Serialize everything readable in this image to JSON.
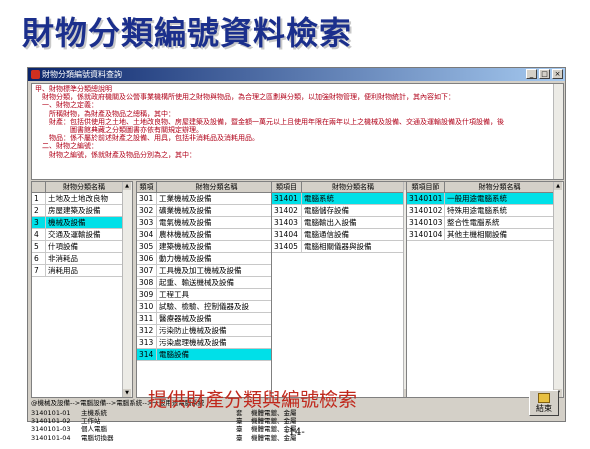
{
  "slide_title": "財物分類編號資料檢索",
  "window": {
    "title": "財物分類編號資料查詢",
    "controls": [
      "_",
      "□",
      "×"
    ]
  },
  "info_lines": [
    "甲、財物標準分類總說明",
    "　財物分類，係就政府機關及公營事業機構所使用之財物與物品，為合理之區劃與分類，以加強財物管理，便利財物統計，其內容如下：",
    "　一、財物之定義：",
    "　　所稱財物，為財產及物品之總稱，其中：",
    "　　財產：包括供使用之土地、土地改良物、房屋建築及設備，暨金額一萬元以上且使用年限在兩年以上之機械及設備、交通及運輸設備及什項設備，後",
    "　　　　　圖書館典藏之分類圖書亦依有關規定辦理。",
    "　　物品：係不屬於前述財產之設備、用具，包括非消耗品及消耗用品。",
    "　二、財物之編號：",
    "　　財物之編號，係就財產及物品分別為之，其中："
  ],
  "list1": {
    "headers": [
      "",
      "財物分類名稱"
    ],
    "rows": [
      [
        "1",
        "土地及土地改良物"
      ],
      [
        "2",
        "房屋建築及設備"
      ],
      [
        "3",
        "機械及設備"
      ],
      [
        "4",
        "交通及運輸設備"
      ],
      [
        "5",
        "什項設備"
      ],
      [
        "6",
        "非消耗品"
      ],
      [
        "7",
        "消耗用品"
      ]
    ],
    "selected": 2
  },
  "list2": {
    "headers": [
      "類項",
      "財物分類名稱"
    ],
    "rows": [
      [
        "301",
        "工業機械及設備"
      ],
      [
        "302",
        "礦業機械及設備"
      ],
      [
        "303",
        "電氣機械及設備"
      ],
      [
        "304",
        "農林機械及設備"
      ],
      [
        "305",
        "建築機械及設備"
      ],
      [
        "306",
        "動力機械及設備"
      ],
      [
        "307",
        "工具機及加工機械及設備"
      ],
      [
        "308",
        "起重、輸送機械及設備"
      ],
      [
        "309",
        "工程工具"
      ],
      [
        "310",
        "試驗、檢驗、控制儀器及設"
      ],
      [
        "311",
        "醫療器械及設備"
      ],
      [
        "312",
        "污染防止機械及設備"
      ],
      [
        "313",
        "污染處理機械及設備"
      ],
      [
        "314",
        "電腦設備"
      ]
    ],
    "selected": 13
  },
  "list3": {
    "headers": [
      "類項目",
      "財物分類名稱"
    ],
    "rows": [
      [
        "31401",
        "電腦系統"
      ],
      [
        "31402",
        "電腦儲存設備"
      ],
      [
        "31403",
        "電腦輸出入設備"
      ],
      [
        "31404",
        "電腦通信設備"
      ],
      [
        "31405",
        "電腦相關儀器與設備"
      ]
    ],
    "selected": 0
  },
  "list4": {
    "headers": [
      "類項目節",
      "財物分類名稱"
    ],
    "rows": [
      [
        "3140101",
        "一般用途電腦系統"
      ],
      [
        "3140102",
        "特殊用途電腦系統"
      ],
      [
        "3140103",
        "整合性電腦系統"
      ],
      [
        "3140104",
        "其他主機相關設備"
      ]
    ],
    "selected": 0
  },
  "path_text": "@機械及設備-->電腦設備-->電腦系統-->一般用途電腦系統",
  "detail_rows": [
    [
      "3140101-01",
      "主機系統",
      "套",
      "機體電鍍、金屬"
    ],
    [
      "3140101-02",
      "工作站",
      "臺",
      "機體電鍍、金屬"
    ],
    [
      "3140101-03",
      "個人電腦",
      "臺",
      "機體電鍍、金屬"
    ],
    [
      "3140101-04",
      "電腦切換器",
      "臺",
      "機體電鍍、金屬"
    ]
  ],
  "exit_button": "結束",
  "caption": "提供財產分類與編號檢索",
  "page_number": "-14-"
}
